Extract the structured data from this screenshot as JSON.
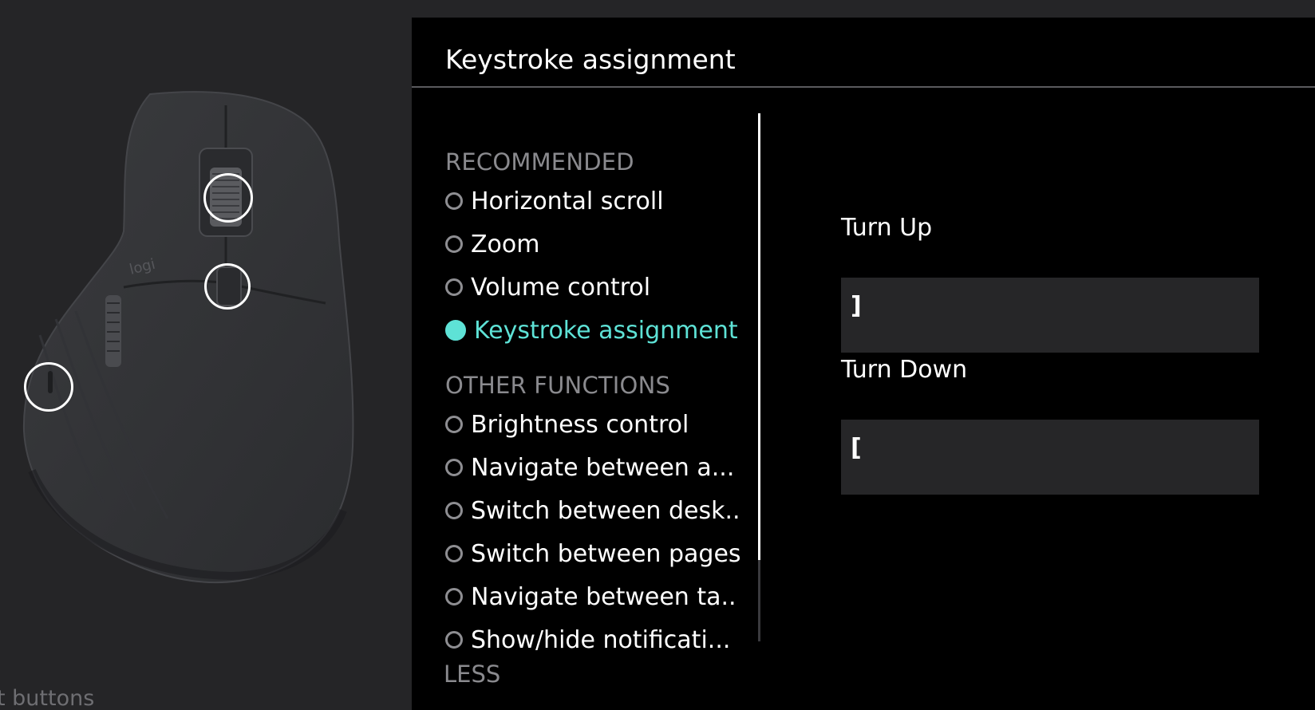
{
  "panel": {
    "title": "Keystroke assignment"
  },
  "sections": {
    "recommended": "RECOMMENDED",
    "other": "OTHER FUNCTIONS"
  },
  "options": {
    "recommended": [
      {
        "label": "Horizontal scroll",
        "selected": false
      },
      {
        "label": "Zoom",
        "selected": false
      },
      {
        "label": "Volume control",
        "selected": false
      },
      {
        "label": "Keystroke assignment",
        "selected": true
      }
    ],
    "other": [
      {
        "label": "Brightness control",
        "selected": false
      },
      {
        "label": "Navigate between a...",
        "selected": false
      },
      {
        "label": "Switch between desk..",
        "selected": false
      },
      {
        "label": "Switch between pages",
        "selected": false
      },
      {
        "label": "Navigate between ta..",
        "selected": false
      },
      {
        "label": "Show/hide notificati...",
        "selected": false
      }
    ]
  },
  "less_label": "LESS",
  "keystroke": {
    "turn_up_label": "Turn Up",
    "turn_up_value": "]",
    "turn_down_label": "Turn Down",
    "turn_down_value": "["
  },
  "mouse": {
    "brand": "logi"
  },
  "left_footer": "t buttons",
  "colors": {
    "accent": "#5ee2d6",
    "panel_bg": "#000000",
    "app_bg": "#252527",
    "field_bg": "#262628"
  }
}
